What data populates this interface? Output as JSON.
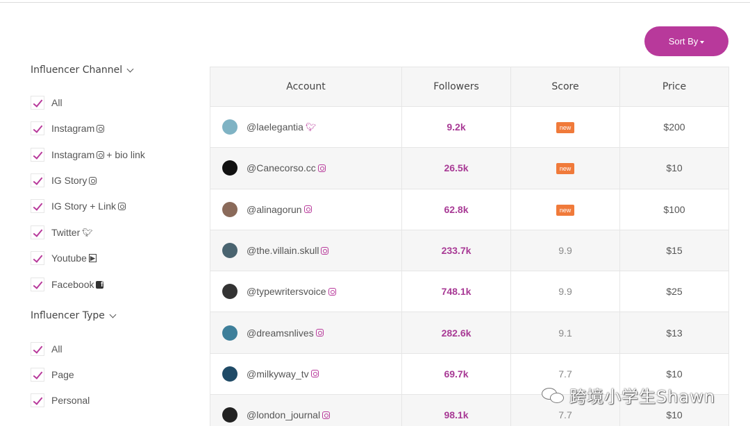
{
  "sort": {
    "label": "Sort By"
  },
  "filters": {
    "channel_title": "Influencer Channel",
    "channels": [
      {
        "label": "All",
        "icon": ""
      },
      {
        "label": "Instagram",
        "icon": "instagram-icon"
      },
      {
        "label": "Instagram",
        "suffix": "+ bio link",
        "icon": "instagram-icon"
      },
      {
        "label": "IG Story",
        "icon": "instagram-icon"
      },
      {
        "label": "IG Story + Link",
        "icon": "instagram-icon"
      },
      {
        "label": "Twitter",
        "icon": "twitter-icon"
      },
      {
        "label": "Youtube",
        "icon": "youtube-icon"
      },
      {
        "label": "Facebook",
        "icon": "facebook-icon"
      }
    ],
    "type_title": "Influencer Type",
    "types": [
      {
        "label": "All"
      },
      {
        "label": "Page"
      },
      {
        "label": "Personal"
      }
    ]
  },
  "table": {
    "headers": [
      "Account",
      "Followers",
      "Score",
      "Price"
    ],
    "rows": [
      {
        "handle": "@laelegantia",
        "icon": "twitter-icon",
        "followers": "9.2k",
        "score": "new",
        "price": "$200",
        "avatar_color": "#7fb3c4"
      },
      {
        "handle": "@Canecorso.cc",
        "icon": "instagram-icon",
        "followers": "26.5k",
        "score": "new",
        "price": "$10",
        "avatar_color": "#111111"
      },
      {
        "handle": "@alinagorun",
        "icon": "instagram-icon",
        "followers": "62.8k",
        "score": "new",
        "price": "$100",
        "avatar_color": "#8a6a5a"
      },
      {
        "handle": "@the.villain.skull",
        "icon": "instagram-icon",
        "followers": "233.7k",
        "score": "9.9",
        "price": "$15",
        "avatar_color": "#4a6470"
      },
      {
        "handle": "@typewritersvoice",
        "icon": "instagram-icon",
        "followers": "748.1k",
        "score": "9.9",
        "price": "$25",
        "avatar_color": "#333333"
      },
      {
        "handle": "@dreamsnlives",
        "icon": "instagram-icon",
        "followers": "282.6k",
        "score": "9.1",
        "price": "$13",
        "avatar_color": "#3e7f9a"
      },
      {
        "handle": "@milkyway_tv",
        "icon": "instagram-icon",
        "followers": "69.7k",
        "score": "7.7",
        "price": "$10",
        "avatar_color": "#1f4a66"
      },
      {
        "handle": "@london_journal",
        "icon": "instagram-icon",
        "followers": "98.1k",
        "score": "7.7",
        "price": "$10",
        "avatar_color": "#222222"
      }
    ]
  },
  "watermark": {
    "text": "跨境小学生Shawn",
    "icon": "wechat-icon"
  },
  "colors": {
    "accent": "#b8399b",
    "new_badge": "#f07a3a",
    "followers_text": "#a83a95"
  }
}
